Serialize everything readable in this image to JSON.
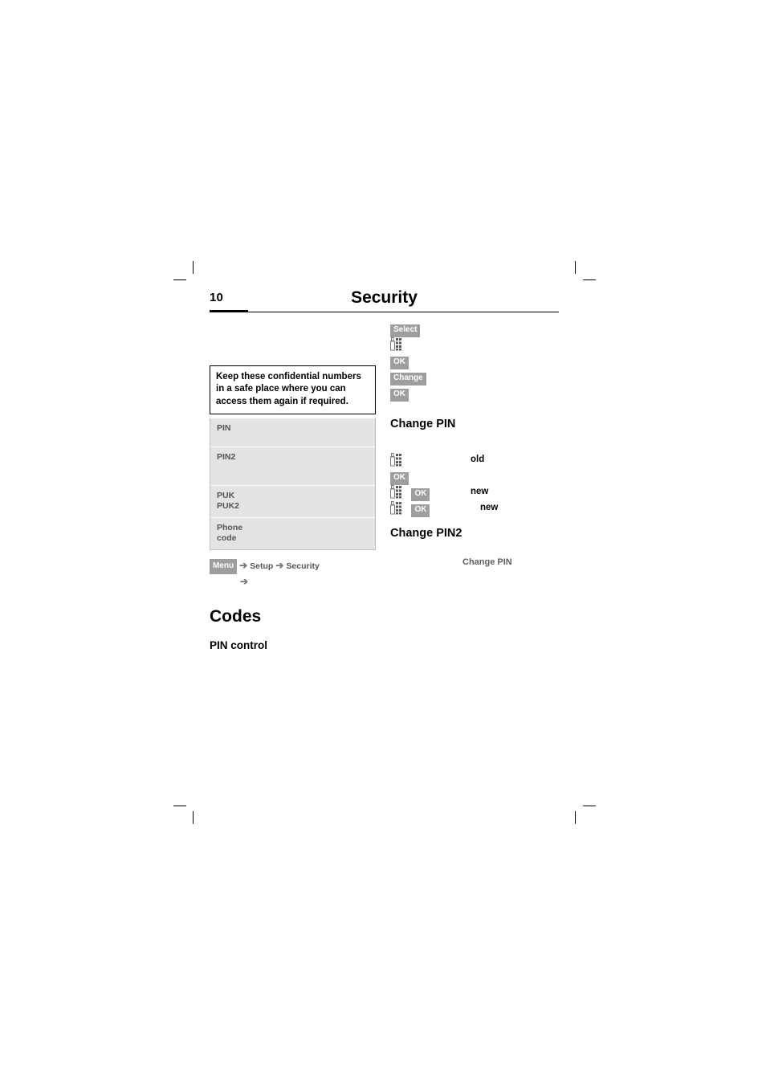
{
  "page": {
    "number": "10",
    "title": "Security"
  },
  "left": {
    "note": "Keep these confidential numbers in a safe place where you can access them again if required.",
    "code_rows": [
      {
        "label": "PIN",
        "sub": ""
      },
      {
        "label": "PIN2",
        "sub": ""
      },
      {
        "label": "PUK",
        "sub": "PUK2"
      },
      {
        "label": "Phone",
        "sub": "code"
      }
    ],
    "path": {
      "menu_key": "Menu",
      "item1": "Setup",
      "item2": "Security",
      "arrow": "➔"
    },
    "section_title": "Codes",
    "subsection_title": "PIN control"
  },
  "right": {
    "steps_top": [
      {
        "key": "Select",
        "icon": "",
        "label": ""
      },
      {
        "key": "",
        "icon": "keypad-icon",
        "label": ""
      },
      {
        "key": "OK",
        "icon": "",
        "label": ""
      },
      {
        "key": "Change",
        "icon": "",
        "label": ""
      },
      {
        "key": "OK",
        "icon": "",
        "label": ""
      }
    ],
    "heading_change_pin": "Change PIN",
    "steps_pin": [
      {
        "icon": "keypad-icon",
        "key": "",
        "label": "old"
      },
      {
        "icon": "",
        "key": "OK",
        "label": ""
      },
      {
        "icon": "keypad-icon",
        "key": "OK",
        "label": "new"
      },
      {
        "icon": "keypad-icon",
        "key": "OK",
        "label": "new"
      }
    ],
    "heading_change_pin2": "Change PIN2",
    "reference": "Change PIN"
  }
}
